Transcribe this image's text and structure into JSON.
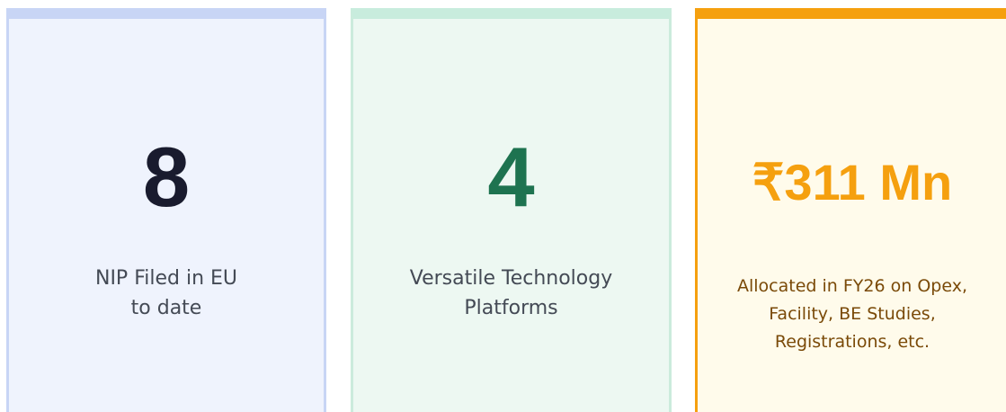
{
  "cards": [
    {
      "value": "8",
      "caption_lines": [
        "NIP Filed in EU",
        "to date"
      ],
      "accent": "#c8d5f5",
      "value_color": "#191b2e"
    },
    {
      "value": "4",
      "caption_lines": [
        "Versatile Technology",
        "Platforms"
      ],
      "accent": "#cbebdc",
      "value_color": "#1e7350"
    },
    {
      "value": "₹311 Mn",
      "caption_lines": [
        "Allocated in FY26 on Opex,",
        "Facility, BE Studies,",
        "Registrations, etc."
      ],
      "accent": "#f5a00f",
      "value_color": "#f5a00f"
    }
  ]
}
